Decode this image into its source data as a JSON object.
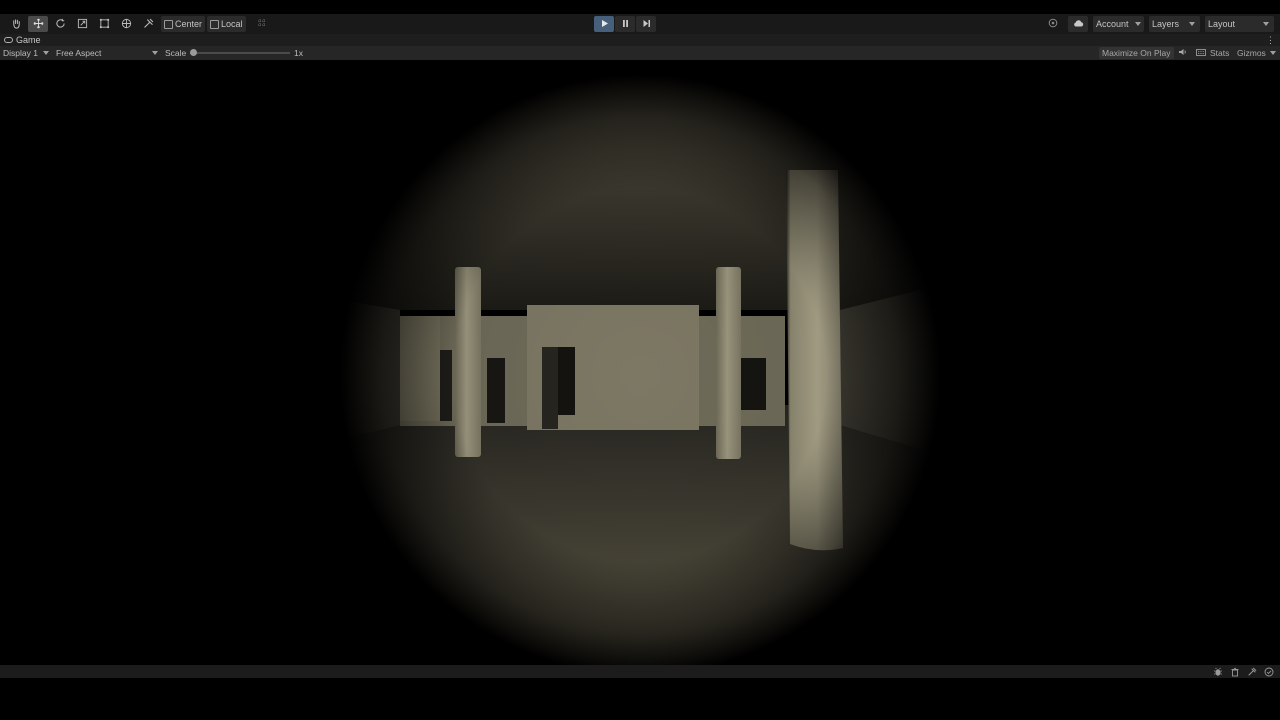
{
  "toolbar": {
    "tools": [
      {
        "name": "hand-tool",
        "icon": "hand-icon",
        "active": false
      },
      {
        "name": "move-tool",
        "icon": "move-icon",
        "active": true
      },
      {
        "name": "rotate-tool",
        "icon": "rotate-icon",
        "active": false
      },
      {
        "name": "scale-tool",
        "icon": "scale-icon",
        "active": false
      },
      {
        "name": "rect-tool",
        "icon": "rect-transform-icon",
        "active": false
      },
      {
        "name": "transform-tool",
        "icon": "transform-icon",
        "active": false
      },
      {
        "name": "custom-tool",
        "icon": "custom-tools-icon",
        "active": false
      }
    ],
    "pivot_mode_label": "Center",
    "pivot_rotation_label": "Local",
    "grid_snap_icon": "grid-snap-icon",
    "play_active": true,
    "account_label": "Account",
    "layers_label": "Layers",
    "layout_label": "Layout",
    "accent_color": "#46607c"
  },
  "game_tab": {
    "label": "Game",
    "icon": "gamepad-icon"
  },
  "game_toolbar": {
    "display_label": "Display 1",
    "aspect_label": "Free Aspect",
    "scale_label": "Scale",
    "scale_value_label": "1x",
    "scale_value": 1,
    "maximize_label": "Maximize On Play",
    "stats_label": "Stats",
    "gizmos_label": "Gizmos"
  },
  "status_bar": {
    "icons": [
      "bug-icon",
      "trash-icon",
      "build-icon",
      "progress-icon"
    ]
  }
}
